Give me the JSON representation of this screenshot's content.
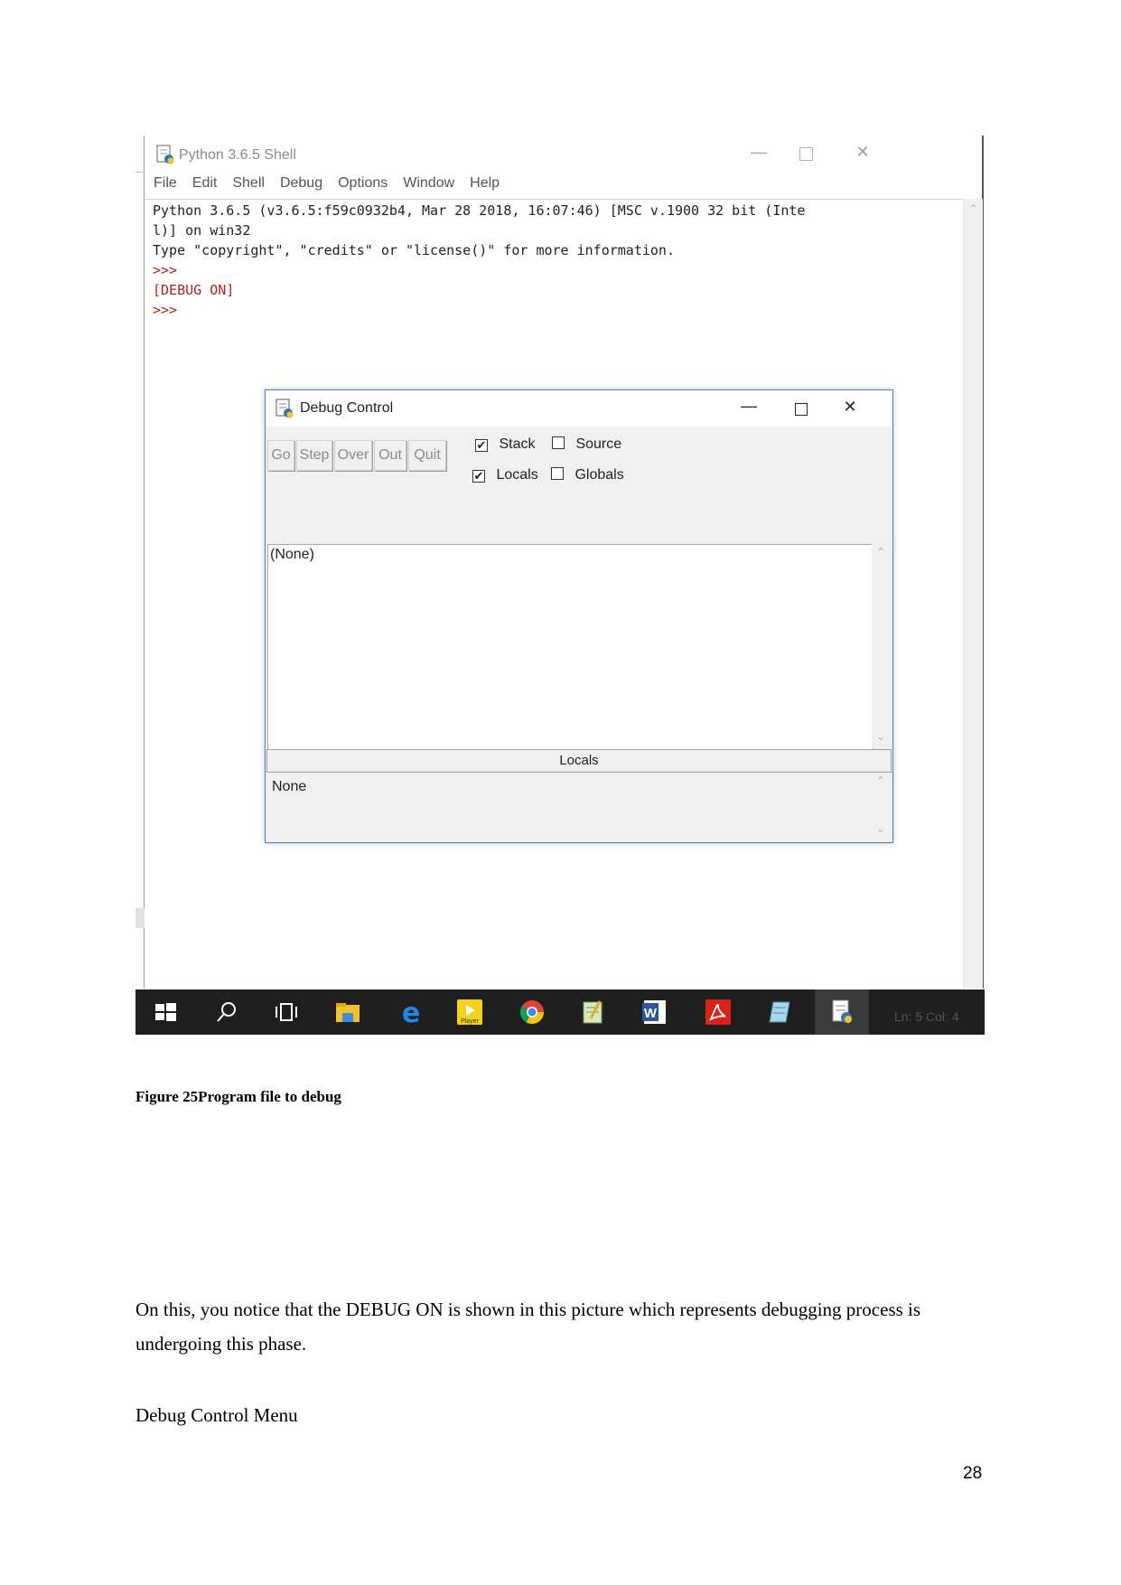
{
  "shell": {
    "title": "Python 3.6.5 Shell",
    "menu": [
      "File",
      "Edit",
      "Shell",
      "Debug",
      "Options",
      "Window",
      "Help"
    ],
    "lines": [
      {
        "text": "Python 3.6.5 (v3.6.5:f59c0932b4, Mar 28 2018, 16:07:46) [MSC v.1900 32 bit (Inte",
        "kind": "out"
      },
      {
        "text": "l)] on win32",
        "kind": "out"
      },
      {
        "text": "Type \"copyright\", \"credits\" or \"license()\" for more information.",
        "kind": "out"
      },
      {
        "text": ">>>",
        "kind": "prompt"
      },
      {
        "text": "[DEBUG ON]",
        "kind": "prompt"
      },
      {
        "text": ">>>",
        "kind": "prompt"
      }
    ]
  },
  "debug": {
    "title": "Debug Control",
    "buttons": [
      "Go",
      "Step",
      "Over",
      "Out",
      "Quit"
    ],
    "checks": {
      "stack": {
        "label": "Stack",
        "checked": true
      },
      "source": {
        "label": "Source",
        "checked": false
      },
      "locals": {
        "label": "Locals",
        "checked": true
      },
      "globals": {
        "label": "Globals",
        "checked": false
      }
    },
    "stack_text": "(None)",
    "locals_header": "Locals",
    "locals_text": "None"
  },
  "taskbar": {
    "status": "Ln: 5  Col: 4",
    "player_label": "Player"
  },
  "caption": "Figure 25Program file to debug",
  "paragraph": "On this, you notice that the DEBUG ON is shown in this picture which represents debugging process is undergoing this phase.",
  "heading": "Debug Control Menu",
  "page_number": "28"
}
